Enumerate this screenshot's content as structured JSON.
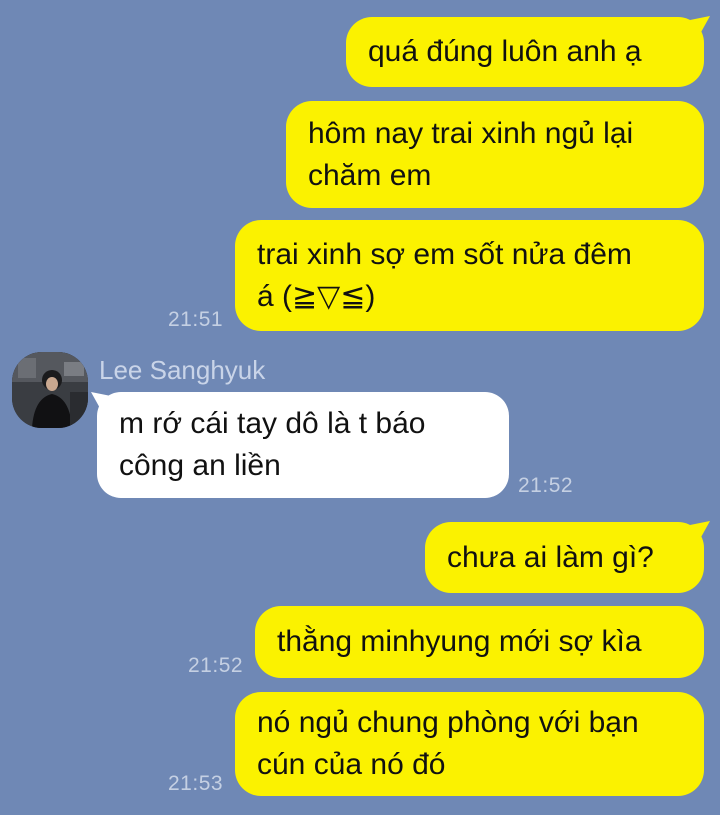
{
  "colors": {
    "background": "#6f88b5",
    "outgoing_bubble": "#fbf200",
    "incoming_bubble": "#ffffff",
    "timestamp": "#c5d0e3"
  },
  "messages": [
    {
      "direction": "outgoing",
      "lines": [
        "quá đúng luôn anh ạ"
      ],
      "time": ""
    },
    {
      "direction": "outgoing",
      "lines": [
        "hôm nay trai xinh ngủ lại",
        "chăm em"
      ],
      "time": ""
    },
    {
      "direction": "outgoing",
      "lines": [
        "trai xinh sợ em sốt nửa đêm",
        "á (≧▽≦)"
      ],
      "time": "21:51"
    },
    {
      "direction": "incoming",
      "sender": "Lee Sanghyuk",
      "lines": [
        "m rớ cái tay dô là t báo",
        "công an liền"
      ],
      "time": "21:52"
    },
    {
      "direction": "outgoing",
      "lines": [
        "chưa ai làm gì?"
      ],
      "time": ""
    },
    {
      "direction": "outgoing",
      "lines": [
        "thằng minhyung mới sợ kìa"
      ],
      "time": "21:52"
    },
    {
      "direction": "outgoing",
      "lines": [
        "nó ngủ chung phòng với bạn",
        "cún của nó đó"
      ],
      "time": "21:53"
    }
  ],
  "avatar_icon": "user-avatar-photo"
}
